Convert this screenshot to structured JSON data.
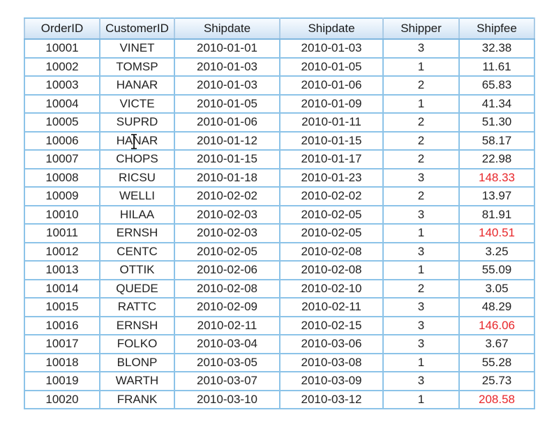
{
  "table": {
    "columns": [
      "OrderID",
      "CustomerID",
      "Shipdate",
      "Shipdate",
      "Shipper",
      "Shipfee"
    ],
    "rows": [
      {
        "order_id": "10001",
        "customer_id": "VINET",
        "shipdate_1": "2010-01-01",
        "shipdate_2": "2010-01-03",
        "shipper": "3",
        "shipfee": "32.38",
        "highlight": false
      },
      {
        "order_id": "10002",
        "customer_id": "TOMSP",
        "shipdate_1": "2010-01-03",
        "shipdate_2": "2010-01-05",
        "shipper": "1",
        "shipfee": "11.61",
        "highlight": false
      },
      {
        "order_id": "10003",
        "customer_id": "HANAR",
        "shipdate_1": "2010-01-03",
        "shipdate_2": "2010-01-06",
        "shipper": "2",
        "shipfee": "65.83",
        "highlight": false
      },
      {
        "order_id": "10004",
        "customer_id": "VICTE",
        "shipdate_1": "2010-01-05",
        "shipdate_2": "2010-01-09",
        "shipper": "1",
        "shipfee": "41.34",
        "highlight": false
      },
      {
        "order_id": "10005",
        "customer_id": "SUPRD",
        "shipdate_1": "2010-01-06",
        "shipdate_2": "2010-01-11",
        "shipper": "2",
        "shipfee": "51.30",
        "highlight": false
      },
      {
        "order_id": "10006",
        "customer_id": "HANAR",
        "shipdate_1": "2010-01-12",
        "shipdate_2": "2010-01-15",
        "shipper": "2",
        "shipfee": "58.17",
        "highlight": false
      },
      {
        "order_id": "10007",
        "customer_id": "CHOPS",
        "shipdate_1": "2010-01-15",
        "shipdate_2": "2010-01-17",
        "shipper": "2",
        "shipfee": "22.98",
        "highlight": false
      },
      {
        "order_id": "10008",
        "customer_id": "RICSU",
        "shipdate_1": "2010-01-18",
        "shipdate_2": "2010-01-23",
        "shipper": "3",
        "shipfee": "148.33",
        "highlight": true
      },
      {
        "order_id": "10009",
        "customer_id": "WELLI",
        "shipdate_1": "2010-02-02",
        "shipdate_2": "2010-02-02",
        "shipper": "2",
        "shipfee": "13.97",
        "highlight": false
      },
      {
        "order_id": "10010",
        "customer_id": "HILAA",
        "shipdate_1": "2010-02-03",
        "shipdate_2": "2010-02-05",
        "shipper": "3",
        "shipfee": "81.91",
        "highlight": false
      },
      {
        "order_id": "10011",
        "customer_id": "ERNSH",
        "shipdate_1": "2010-02-03",
        "shipdate_2": "2010-02-05",
        "shipper": "1",
        "shipfee": "140.51",
        "highlight": true
      },
      {
        "order_id": "10012",
        "customer_id": "CENTC",
        "shipdate_1": "2010-02-05",
        "shipdate_2": "2010-02-08",
        "shipper": "3",
        "shipfee": "3.25",
        "highlight": false
      },
      {
        "order_id": "10013",
        "customer_id": "OTTIK",
        "shipdate_1": "2010-02-06",
        "shipdate_2": "2010-02-08",
        "shipper": "1",
        "shipfee": "55.09",
        "highlight": false
      },
      {
        "order_id": "10014",
        "customer_id": "QUEDE",
        "shipdate_1": "2010-02-08",
        "shipdate_2": "2010-02-10",
        "shipper": "2",
        "shipfee": "3.05",
        "highlight": false
      },
      {
        "order_id": "10015",
        "customer_id": "RATTC",
        "shipdate_1": "2010-02-09",
        "shipdate_2": "2010-02-11",
        "shipper": "3",
        "shipfee": "48.29",
        "highlight": false
      },
      {
        "order_id": "10016",
        "customer_id": "ERNSH",
        "shipdate_1": "2010-02-11",
        "shipdate_2": "2010-02-15",
        "shipper": "3",
        "shipfee": "146.06",
        "highlight": true
      },
      {
        "order_id": "10017",
        "customer_id": "FOLKO",
        "shipdate_1": "2010-03-04",
        "shipdate_2": "2010-03-06",
        "shipper": "3",
        "shipfee": "3.67",
        "highlight": false
      },
      {
        "order_id": "10018",
        "customer_id": "BLONP",
        "shipdate_1": "2010-03-05",
        "shipdate_2": "2010-03-08",
        "shipper": "1",
        "shipfee": "55.28",
        "highlight": false
      },
      {
        "order_id": "10019",
        "customer_id": "WARTH",
        "shipdate_1": "2010-03-07",
        "shipdate_2": "2010-03-09",
        "shipper": "3",
        "shipfee": "25.73",
        "highlight": false
      },
      {
        "order_id": "10020",
        "customer_id": "FRANK",
        "shipdate_1": "2010-03-10",
        "shipdate_2": "2010-03-12",
        "shipper": "1",
        "shipfee": "208.58",
        "highlight": true
      }
    ]
  },
  "colors": {
    "header_gradient_top": "#f7fbff",
    "header_gradient_bottom": "#cfe2f4",
    "grid_line": "#8cc3e8",
    "grid_line_major": "#4e9fd9",
    "text": "#222222",
    "highlight_fee": "#e8262a"
  },
  "cursor": {
    "icon": "text-ibeam-cursor"
  }
}
